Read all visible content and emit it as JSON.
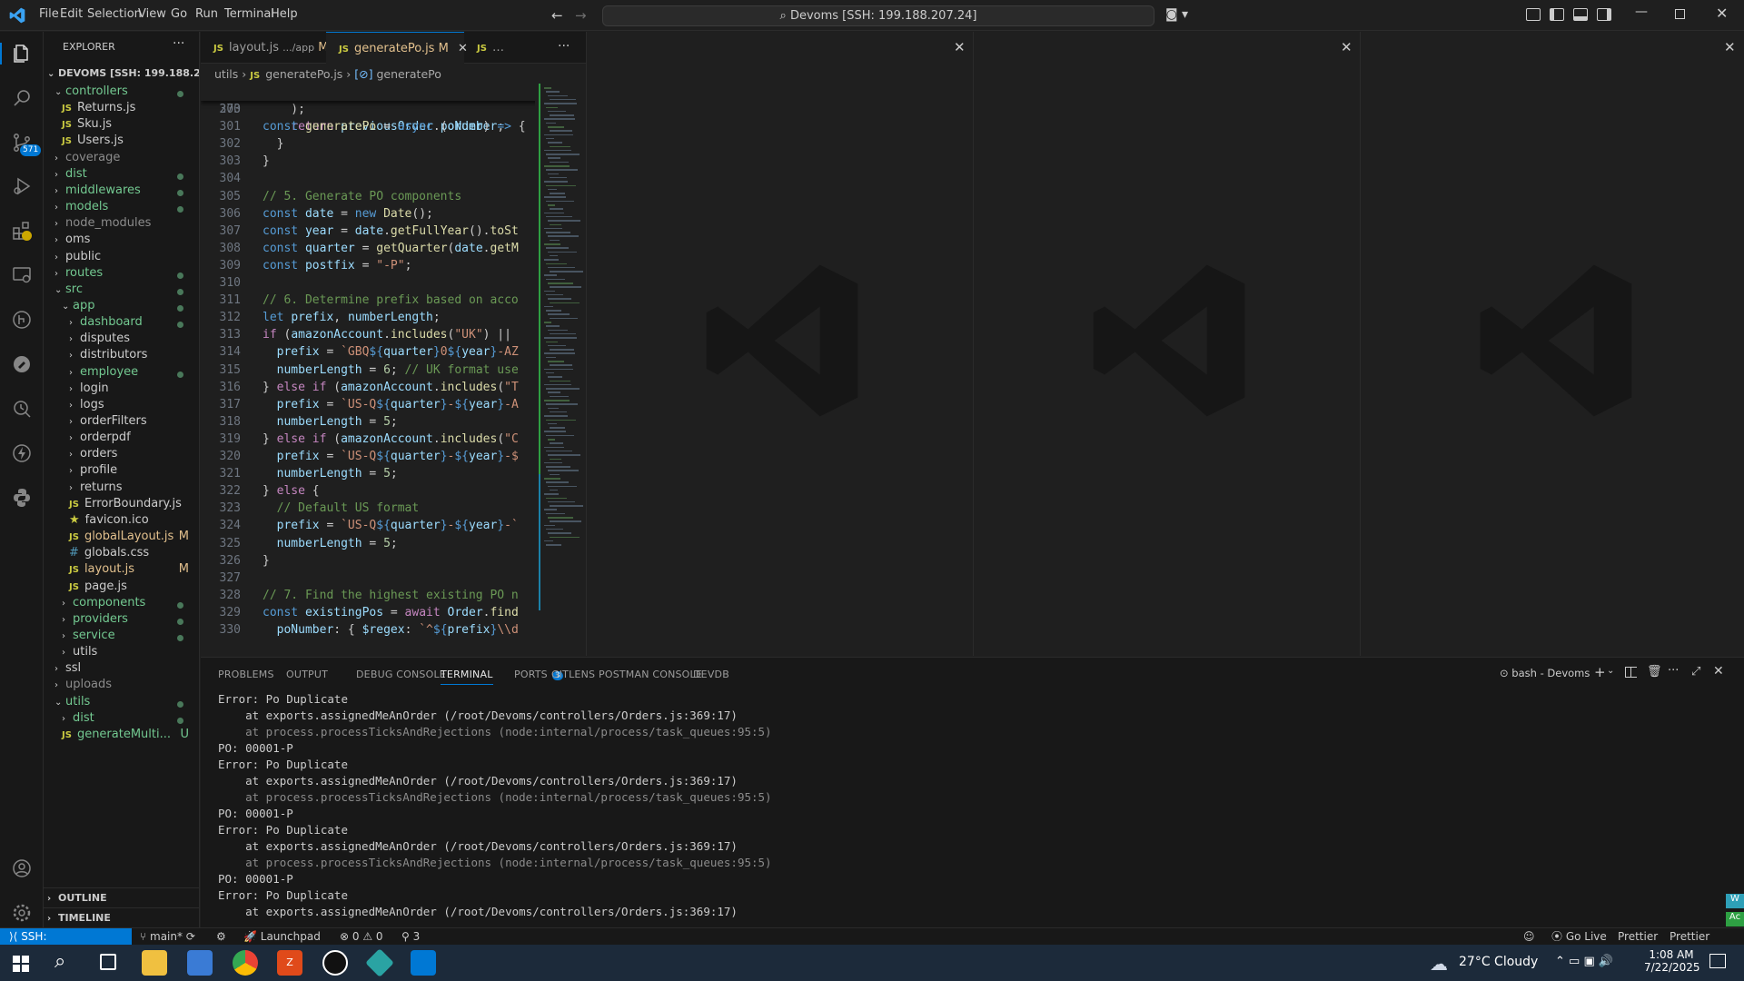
{
  "menu": [
    "File",
    "Edit",
    "Selection",
    "View",
    "Go",
    "Run",
    "Terminal",
    "Help"
  ],
  "command_center": "Devoms [SSH: 199.188.207.24]",
  "activity": {
    "scm_badge": "571"
  },
  "explorer": {
    "title": "EXPLORER",
    "root": "DEVOMS [SSH: 199.188.20...",
    "items": [
      {
        "label": "controllers",
        "kind": "folder-open",
        "depth": 1,
        "color": "#73c991",
        "dot": true
      },
      {
        "label": "Returns.js",
        "kind": "js",
        "depth": 2,
        "color": "#cccccc"
      },
      {
        "label": "Sku.js",
        "kind": "js",
        "depth": 2,
        "color": "#cccccc"
      },
      {
        "label": "Users.js",
        "kind": "js",
        "depth": 2,
        "color": "#cccccc"
      },
      {
        "label": "coverage",
        "kind": "folder",
        "depth": 1,
        "color": "#8c8c8c"
      },
      {
        "label": "dist",
        "kind": "folder",
        "depth": 1,
        "color": "#73c991",
        "dot": true
      },
      {
        "label": "middlewares",
        "kind": "folder",
        "depth": 1,
        "color": "#73c991",
        "dot": true
      },
      {
        "label": "models",
        "kind": "folder",
        "depth": 1,
        "color": "#73c991",
        "dot": true
      },
      {
        "label": "node_modules",
        "kind": "folder",
        "depth": 1,
        "color": "#8c8c8c"
      },
      {
        "label": "oms",
        "kind": "folder",
        "depth": 1,
        "color": "#cccccc"
      },
      {
        "label": "public",
        "kind": "folder",
        "depth": 1,
        "color": "#cccccc"
      },
      {
        "label": "routes",
        "kind": "folder",
        "depth": 1,
        "color": "#73c991",
        "dot": true
      },
      {
        "label": "src",
        "kind": "folder-open",
        "depth": 1,
        "color": "#73c991",
        "dot": true
      },
      {
        "label": "app",
        "kind": "folder-open",
        "depth": 2,
        "color": "#73c991",
        "dot": true
      },
      {
        "label": "dashboard",
        "kind": "folder",
        "depth": 3,
        "color": "#73c991",
        "dot": true
      },
      {
        "label": "disputes",
        "kind": "folder",
        "depth": 3,
        "color": "#cccccc"
      },
      {
        "label": "distributors",
        "kind": "folder",
        "depth": 3,
        "color": "#cccccc"
      },
      {
        "label": "employee",
        "kind": "folder",
        "depth": 3,
        "color": "#73c991",
        "dot": true
      },
      {
        "label": "login",
        "kind": "folder",
        "depth": 3,
        "color": "#cccccc"
      },
      {
        "label": "logs",
        "kind": "folder",
        "depth": 3,
        "color": "#cccccc"
      },
      {
        "label": "orderFilters",
        "kind": "folder",
        "depth": 3,
        "color": "#cccccc"
      },
      {
        "label": "orderpdf",
        "kind": "folder",
        "depth": 3,
        "color": "#cccccc"
      },
      {
        "label": "orders",
        "kind": "folder",
        "depth": 3,
        "color": "#cccccc"
      },
      {
        "label": "profile",
        "kind": "folder",
        "depth": 3,
        "color": "#cccccc"
      },
      {
        "label": "returns",
        "kind": "folder",
        "depth": 3,
        "color": "#cccccc"
      },
      {
        "label": "ErrorBoundary.js",
        "kind": "js",
        "depth": 3,
        "color": "#cccccc"
      },
      {
        "label": "favicon.ico",
        "kind": "star",
        "depth": 3,
        "color": "#cccccc"
      },
      {
        "label": "globalLayout.js",
        "kind": "js",
        "depth": 3,
        "color": "#e2c08d",
        "badge": "M"
      },
      {
        "label": "globals.css",
        "kind": "css",
        "depth": 3,
        "color": "#cccccc"
      },
      {
        "label": "layout.js",
        "kind": "js",
        "depth": 3,
        "color": "#e2c08d",
        "badge": "M"
      },
      {
        "label": "page.js",
        "kind": "js",
        "depth": 3,
        "color": "#cccccc"
      },
      {
        "label": "components",
        "kind": "folder",
        "depth": 2,
        "color": "#73c991",
        "dot": true
      },
      {
        "label": "providers",
        "kind": "folder",
        "depth": 2,
        "color": "#73c991",
        "dot": true
      },
      {
        "label": "service",
        "kind": "folder",
        "depth": 2,
        "color": "#73c991",
        "dot": true
      },
      {
        "label": "utils",
        "kind": "folder",
        "depth": 2,
        "color": "#cccccc"
      },
      {
        "label": "ssl",
        "kind": "folder",
        "depth": 1,
        "color": "#cccccc"
      },
      {
        "label": "uploads",
        "kind": "folder",
        "depth": 1,
        "color": "#8c8c8c"
      },
      {
        "label": "utils",
        "kind": "folder-open",
        "depth": 1,
        "color": "#73c991",
        "dot": true
      },
      {
        "label": "dist",
        "kind": "folder",
        "depth": 2,
        "color": "#73c991",
        "dot": true
      },
      {
        "label": "generateMulti...",
        "kind": "js",
        "depth": 2,
        "color": "#73c991",
        "badge": "U"
      }
    ],
    "outline": "OUTLINE",
    "timeline": "TIMELINE"
  },
  "tabs": [
    {
      "label": "layout.js",
      "suffix": ".../app",
      "badge": "M",
      "active": false
    },
    {
      "label": "generatePo.js",
      "suffix": "",
      "badge": "M",
      "active": true
    }
  ],
  "breadcrumb": [
    "utils",
    "generatePo.js",
    "generatePo"
  ],
  "code": {
    "sticky": {
      "ln": "273",
      "html": "<span class=\"kw\">const</span> <span class=\"fn\">generatePo</span> = <span class=\"kw\">async</span> (<span class=\"var\">order</span>) <span class=\"kw\">=></span> {"
    },
    "lines": [
      {
        "ln": "300",
        "html": "    );"
      },
      {
        "ln": "301",
        "html": "    <span class=\"ctl\">return</span> <span class=\"var\">previousOrder</span>.<span class=\"var\">poNumber</span>;"
      },
      {
        "ln": "302",
        "html": "  }"
      },
      {
        "ln": "303",
        "html": "}"
      },
      {
        "ln": "304",
        "html": ""
      },
      {
        "ln": "305",
        "html": "<span class=\"cm\">// 5. Generate PO components</span>"
      },
      {
        "ln": "306",
        "html": "<span class=\"kw\">const</span> <span class=\"var\">date</span> = <span class=\"kw\">new</span> <span class=\"fn\">Date</span>();"
      },
      {
        "ln": "307",
        "html": "<span class=\"kw\">const</span> <span class=\"var\">year</span> = <span class=\"var\">date</span>.<span class=\"fn\">getFullYear</span>().<span class=\"fn\">toSt</span>"
      },
      {
        "ln": "308",
        "html": "<span class=\"kw\">const</span> <span class=\"var\">quarter</span> = <span class=\"fn\">getQuarter</span>(<span class=\"var\">date</span>.<span class=\"fn\">getM</span>"
      },
      {
        "ln": "309",
        "html": "<span class=\"kw\">const</span> <span class=\"var\">postfix</span> = <span class=\"str\">\"-P\"</span>;"
      },
      {
        "ln": "310",
        "html": ""
      },
      {
        "ln": "311",
        "html": "<span class=\"cm\">// 6. Determine prefix based on acco</span>"
      },
      {
        "ln": "312",
        "html": "<span class=\"kw\">let</span> <span class=\"var\">prefix</span>, <span class=\"var\">numberLength</span>;"
      },
      {
        "ln": "313",
        "html": "<span class=\"ctl\">if</span> (<span class=\"var\">amazonAccount</span>.<span class=\"fn\">includes</span>(<span class=\"str\">\"UK\"</span>) ||"
      },
      {
        "ln": "314",
        "html": "  <span class=\"var\">prefix</span> = <span class=\"str\">`GBQ</span><span class=\"kw\">${</span><span class=\"var\">quarter</span><span class=\"kw\">}</span><span class=\"str\">0</span><span class=\"kw\">${</span><span class=\"var\">year</span><span class=\"kw\">}</span><span class=\"str\">-AZ</span>"
      },
      {
        "ln": "315",
        "html": "  <span class=\"var\">numberLength</span> = <span class=\"num\">6</span>; <span class=\"cm\">// UK format use</span>"
      },
      {
        "ln": "316",
        "html": "} <span class=\"ctl\">else if</span> (<span class=\"var\">amazonAccount</span>.<span class=\"fn\">includes</span>(<span class=\"str\">\"T</span>"
      },
      {
        "ln": "317",
        "html": "  <span class=\"var\">prefix</span> = <span class=\"str\">`US-Q</span><span class=\"kw\">${</span><span class=\"var\">quarter</span><span class=\"kw\">}</span><span class=\"str\">-</span><span class=\"kw\">${</span><span class=\"var\">year</span><span class=\"kw\">}</span><span class=\"str\">-A</span>"
      },
      {
        "ln": "318",
        "html": "  <span class=\"var\">numberLength</span> = <span class=\"num\">5</span>;"
      },
      {
        "ln": "319",
        "html": "} <span class=\"ctl\">else if</span> (<span class=\"var\">amazonAccount</span>.<span class=\"fn\">includes</span>(<span class=\"str\">\"C</span>"
      },
      {
        "ln": "320",
        "html": "  <span class=\"var\">prefix</span> = <span class=\"str\">`US-Q</span><span class=\"kw\">${</span><span class=\"var\">quarter</span><span class=\"kw\">}</span><span class=\"str\">-</span><span class=\"kw\">${</span><span class=\"var\">year</span><span class=\"kw\">}</span><span class=\"str\">-$</span>"
      },
      {
        "ln": "321",
        "html": "  <span class=\"var\">numberLength</span> = <span class=\"num\">5</span>;"
      },
      {
        "ln": "322",
        "html": "} <span class=\"ctl\">else</span> {"
      },
      {
        "ln": "323",
        "html": "  <span class=\"cm\">// Default US format</span>"
      },
      {
        "ln": "324",
        "html": "  <span class=\"var\">prefix</span> = <span class=\"str\">`US-Q</span><span class=\"kw\">${</span><span class=\"var\">quarter</span><span class=\"kw\">}</span><span class=\"str\">-</span><span class=\"kw\">${</span><span class=\"var\">year</span><span class=\"kw\">}</span><span class=\"str\">-`</span>"
      },
      {
        "ln": "325",
        "html": "  <span class=\"var\">numberLength</span> = <span class=\"num\">5</span>;"
      },
      {
        "ln": "326",
        "html": "}"
      },
      {
        "ln": "327",
        "html": ""
      },
      {
        "ln": "328",
        "html": "<span class=\"cm\">// 7. Find the highest existing PO n</span>"
      },
      {
        "ln": "329",
        "html": "<span class=\"kw\">const</span> <span class=\"var\">existingPos</span> = <span class=\"ctl\">await</span> <span class=\"var\">Order</span>.<span class=\"fn\">find</span>"
      },
      {
        "ln": "330",
        "html": "  <span class=\"var\">poNumber</span>: { <span class=\"var\">$regex</span>: <span class=\"str\">`^</span><span class=\"kw\">${</span><span class=\"var\">prefix</span><span class=\"kw\">}</span><span class=\"str\">\\\\d</span>"
      }
    ]
  },
  "panel": {
    "tabs": [
      "PROBLEMS",
      "OUTPUT",
      "DEBUG CONSOLE",
      "TERMINAL",
      "PORTS",
      "GITLENS",
      "POSTMAN CONSOLE",
      "DEVDB"
    ],
    "ports_badge": "3",
    "terminal_name": "bash - Devoms",
    "terminal": [
      {
        "text": "Error: Po Duplicate",
        "dim": false
      },
      {
        "text": "    at exports.assignedMeAnOrder (/root/Devoms/controllers/Orders.js:369:17)",
        "dim": false
      },
      {
        "text": "    at process.processTicksAndRejections (node:internal/process/task_queues:95:5)",
        "dim": true
      },
      {
        "text": "PO: 00001-P",
        "dim": false
      },
      {
        "text": "Error: Po Duplicate",
        "dim": false
      },
      {
        "text": "    at exports.assignedMeAnOrder (/root/Devoms/controllers/Orders.js:369:17)",
        "dim": false
      },
      {
        "text": "    at process.processTicksAndRejections (node:internal/process/task_queues:95:5)",
        "dim": true
      },
      {
        "text": "PO: 00001-P",
        "dim": false
      },
      {
        "text": "Error: Po Duplicate",
        "dim": false
      },
      {
        "text": "    at exports.assignedMeAnOrder (/root/Devoms/controllers/Orders.js:369:17)",
        "dim": false
      },
      {
        "text": "    at process.processTicksAndRejections (node:internal/process/task_queues:95:5)",
        "dim": true
      },
      {
        "text": "PO: 00001-P",
        "dim": false
      },
      {
        "text": "Error: Po Duplicate",
        "dim": false
      },
      {
        "text": "    at exports.assignedMeAnOrder (/root/Devoms/controllers/Orders.js:369:17)",
        "dim": false
      }
    ]
  },
  "status": {
    "ssh": "SSH: 199.188.207.24",
    "branch": "main*",
    "launchpad": "Launchpad",
    "errors": "0",
    "warnings": "0",
    "ports": "3",
    "golive": "Go Live",
    "prettier1": "Prettier",
    "prettier2": "Prettier"
  },
  "taskbar": {
    "weather_temp": "27°C",
    "weather_desc": "Cloudy",
    "time": "1:08 AM",
    "date": "7/22/2025"
  }
}
